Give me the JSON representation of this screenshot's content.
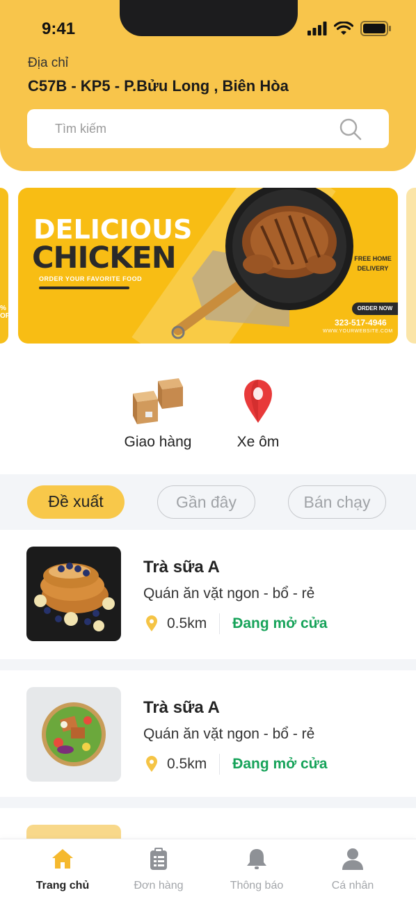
{
  "status_bar": {
    "time": "9:41"
  },
  "header": {
    "address_label": "Địa chỉ",
    "address_value": "C57B - KP5 - P.Bửu Long , Biên Hòa",
    "search_placeholder": "Tìm kiếm"
  },
  "banner": {
    "title_line1": "DELICIOUS",
    "title_line2": "CHICKEN",
    "subtitle": "ORDER YOUR FAVORITE FOOD",
    "delivery_text": "FREE HOME DELIVERY",
    "order_button": "ORDER NOW",
    "phone": "323-517-4946",
    "website": "WWW.YOURWEBSITE.COM",
    "left_peek_text": "% OFF"
  },
  "categories": [
    {
      "label": "Giao hàng",
      "icon": "boxes-icon"
    },
    {
      "label": "Xe ôm",
      "icon": "map-pin-icon"
    }
  ],
  "tabs": [
    {
      "label": "Đề xuất",
      "active": true
    },
    {
      "label": "Gần đây",
      "active": false
    },
    {
      "label": "Bán chạy",
      "active": false
    }
  ],
  "shops": [
    {
      "name": "Trà sữa A",
      "description": "Quán ăn vặt ngon - bổ - rẻ",
      "distance": "0.5km",
      "status": "Đang mở cửa",
      "image": "french-toast-photo"
    },
    {
      "name": "Trà sữa A",
      "description": "Quán ăn vặt ngon - bổ - rẻ",
      "distance": "0.5km",
      "status": "Đang mở cửa",
      "image": "salad-bowl-photo"
    }
  ],
  "bottom_nav": [
    {
      "label": "Trang chủ",
      "icon": "home-icon",
      "active": true
    },
    {
      "label": "Đơn hàng",
      "icon": "clipboard-icon",
      "active": false
    },
    {
      "label": "Thông báo",
      "icon": "bell-icon",
      "active": false
    },
    {
      "label": "Cá nhân",
      "icon": "user-icon",
      "active": false
    }
  ],
  "colors": {
    "accent": "#F8C54B",
    "open_status": "#17A35A",
    "inactive": "#A3A6AA"
  }
}
